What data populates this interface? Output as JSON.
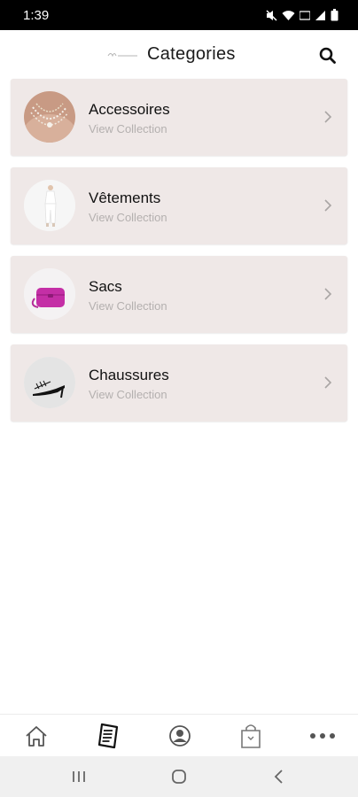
{
  "status": {
    "time": "1:39"
  },
  "header": {
    "title": "Categories",
    "logo_icon": "brand-logo",
    "search_icon": "search-icon"
  },
  "categories": [
    {
      "name": "Accessoires",
      "subtitle": "View Collection",
      "image": "necklace-photo"
    },
    {
      "name": "Vêtements",
      "subtitle": "View Collection",
      "image": "white-outfit-photo"
    },
    {
      "name": "Sacs",
      "subtitle": "View Collection",
      "image": "magenta-bag-photo"
    },
    {
      "name": "Chaussures",
      "subtitle": "View Collection",
      "image": "black-heels-photo"
    }
  ],
  "tabs": [
    {
      "icon": "home-icon"
    },
    {
      "icon": "catalog-icon",
      "active": true
    },
    {
      "icon": "account-icon"
    },
    {
      "icon": "shopping-bag-icon"
    },
    {
      "icon": "more-icon"
    }
  ],
  "colors": {
    "card_bg": "#efe8e7",
    "subtitle": "#b4b0af",
    "accent_bag": "#c42fa6"
  }
}
